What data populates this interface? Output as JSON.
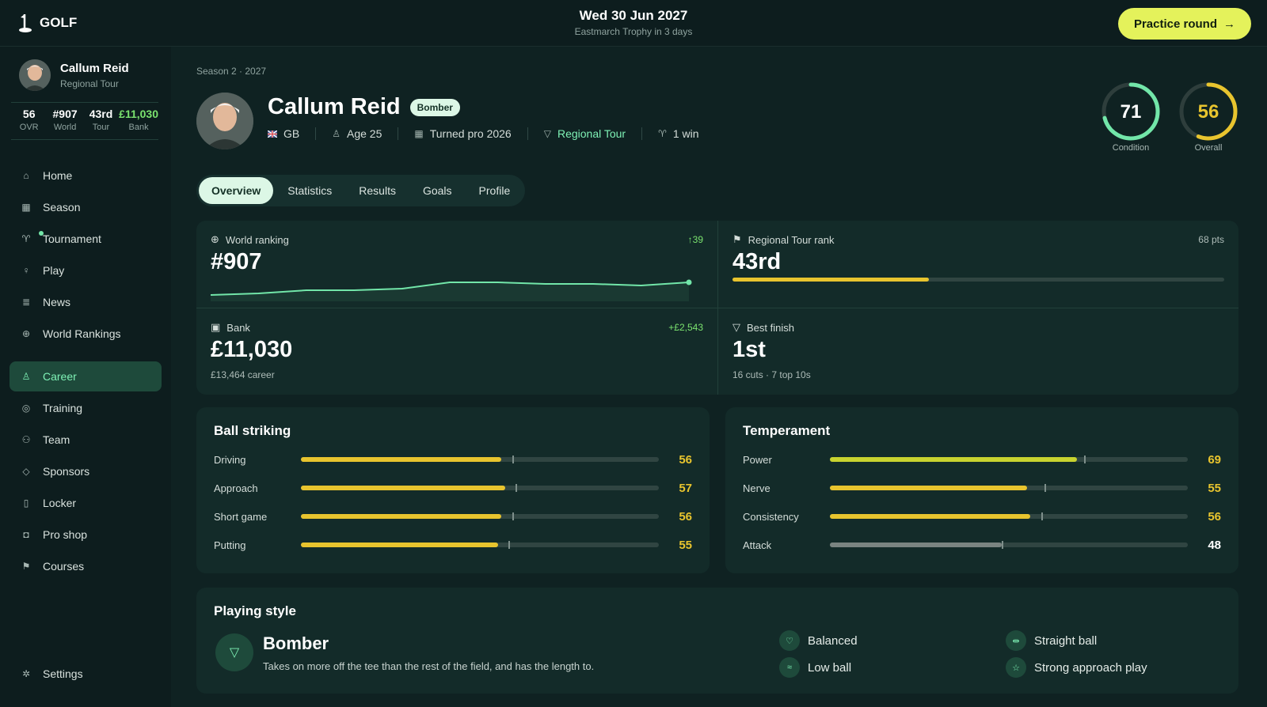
{
  "app": {
    "logo": "GOLF"
  },
  "topbar": {
    "date": "Wed 30 Jun 2027",
    "subtitle": "Eastmarch Trophy in 3 days",
    "practice_label": "Practice round"
  },
  "sidebar": {
    "name": "Callum Reid",
    "tour": "Regional Tour",
    "stats": [
      {
        "value": "56",
        "label": "OVR"
      },
      {
        "value": "#907",
        "label": "World"
      },
      {
        "value": "43rd",
        "label": "Tour"
      },
      {
        "value": "£11,030",
        "label": "Bank"
      }
    ],
    "nav_top": [
      {
        "label": "Home",
        "icon": "home-icon"
      },
      {
        "label": "Season",
        "icon": "calendar-icon"
      },
      {
        "label": "Tournament",
        "icon": "trophy-icon"
      },
      {
        "label": "Play",
        "icon": "tee-icon"
      },
      {
        "label": "News",
        "icon": "newspaper-icon"
      },
      {
        "label": "World Rankings",
        "icon": "globe-icon"
      }
    ],
    "nav_bottom": [
      {
        "label": "Career",
        "icon": "user-icon"
      },
      {
        "label": "Training",
        "icon": "target-icon"
      },
      {
        "label": "Team",
        "icon": "team-icon"
      },
      {
        "label": "Sponsors",
        "icon": "tag-icon"
      },
      {
        "label": "Locker",
        "icon": "locker-icon"
      },
      {
        "label": "Pro shop",
        "icon": "bag-icon"
      },
      {
        "label": "Courses",
        "icon": "flag-icon"
      }
    ],
    "settings": "Settings"
  },
  "header": {
    "season": "Season 2 · 2027",
    "name": "Callum Reid",
    "badge": "Bomber",
    "meta": {
      "country": "GB",
      "age": "Age 25",
      "turned_pro": "Turned pro 2026",
      "tour": "Regional Tour",
      "wins": "1 win"
    },
    "condition": {
      "value": "71",
      "label": "Condition",
      "fraction": 0.71
    },
    "overall": {
      "value": "56",
      "label": "Overall",
      "fraction": 0.56
    }
  },
  "tabs": [
    "Overview",
    "Statistics",
    "Results",
    "Goals",
    "Profile"
  ],
  "stats": {
    "world": {
      "label": "World ranking",
      "value": "#907",
      "change": "↑39",
      "trend": [
        60,
        59,
        57,
        57,
        56,
        52,
        52,
        53,
        53,
        54,
        52
      ]
    },
    "tour": {
      "label": "Regional Tour rank",
      "value": "43rd",
      "right": "68 pts",
      "progress": 0.4
    },
    "bank": {
      "label": "Bank",
      "value": "£11,030",
      "change": "+£2,543",
      "sub": "£13,464 career"
    },
    "best": {
      "label": "Best finish",
      "value": "1st",
      "sub": "16 cuts · 7 top 10s"
    }
  },
  "ball_striking": {
    "title": "Ball striking",
    "rows": [
      {
        "label": "Driving",
        "value": "56",
        "fill": 0.56,
        "tick": 0.59,
        "color": "#e8c42e"
      },
      {
        "label": "Approach",
        "value": "57",
        "fill": 0.57,
        "tick": 0.6,
        "color": "#e8c42e"
      },
      {
        "label": "Short game",
        "value": "56",
        "fill": 0.56,
        "tick": 0.59,
        "color": "#e8c42e"
      },
      {
        "label": "Putting",
        "value": "55",
        "fill": 0.55,
        "tick": 0.58,
        "color": "#e8c42e"
      }
    ]
  },
  "temperament": {
    "title": "Temperament",
    "rows": [
      {
        "label": "Power",
        "value": "69",
        "fill": 0.69,
        "tick": 0.71,
        "color": "#c8d32f"
      },
      {
        "label": "Nerve",
        "value": "55",
        "fill": 0.55,
        "tick": 0.6,
        "color": "#e8c42e"
      },
      {
        "label": "Consistency",
        "value": "56",
        "fill": 0.56,
        "tick": 0.59,
        "color": "#e8c42e"
      },
      {
        "label": "Attack",
        "value": "48",
        "fill": 0.48,
        "tick": 0.48,
        "color": "#7a8481"
      }
    ]
  },
  "playing_style": {
    "title": "Playing style",
    "name": "Bomber",
    "description": "Takes on more off the tee than the rest of the field, and has the length to.",
    "traits": [
      {
        "label": "Balanced",
        "icon": "heart-icon"
      },
      {
        "label": "Straight ball",
        "icon": "arrows-icon"
      },
      {
        "label": "Low ball",
        "icon": "wind-icon"
      },
      {
        "label": "Strong approach play",
        "icon": "star-icon"
      }
    ]
  }
}
